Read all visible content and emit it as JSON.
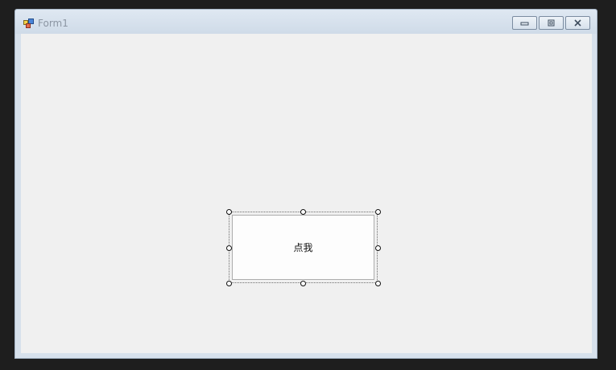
{
  "window": {
    "title": "Form1",
    "icon": "form-icon",
    "controls": [
      {
        "name": "minimize-button",
        "icon": "minimize-icon"
      },
      {
        "name": "restore-button",
        "icon": "restore-icon"
      },
      {
        "name": "close-button",
        "icon": "close-icon"
      }
    ]
  },
  "form": {
    "background": "#f0f0f0",
    "button": {
      "label": "点我",
      "selected": true
    }
  },
  "colors": {
    "editor_background": "#1e1e1e",
    "title_text": "#8c96a3",
    "frame": "#d7e1ec"
  }
}
